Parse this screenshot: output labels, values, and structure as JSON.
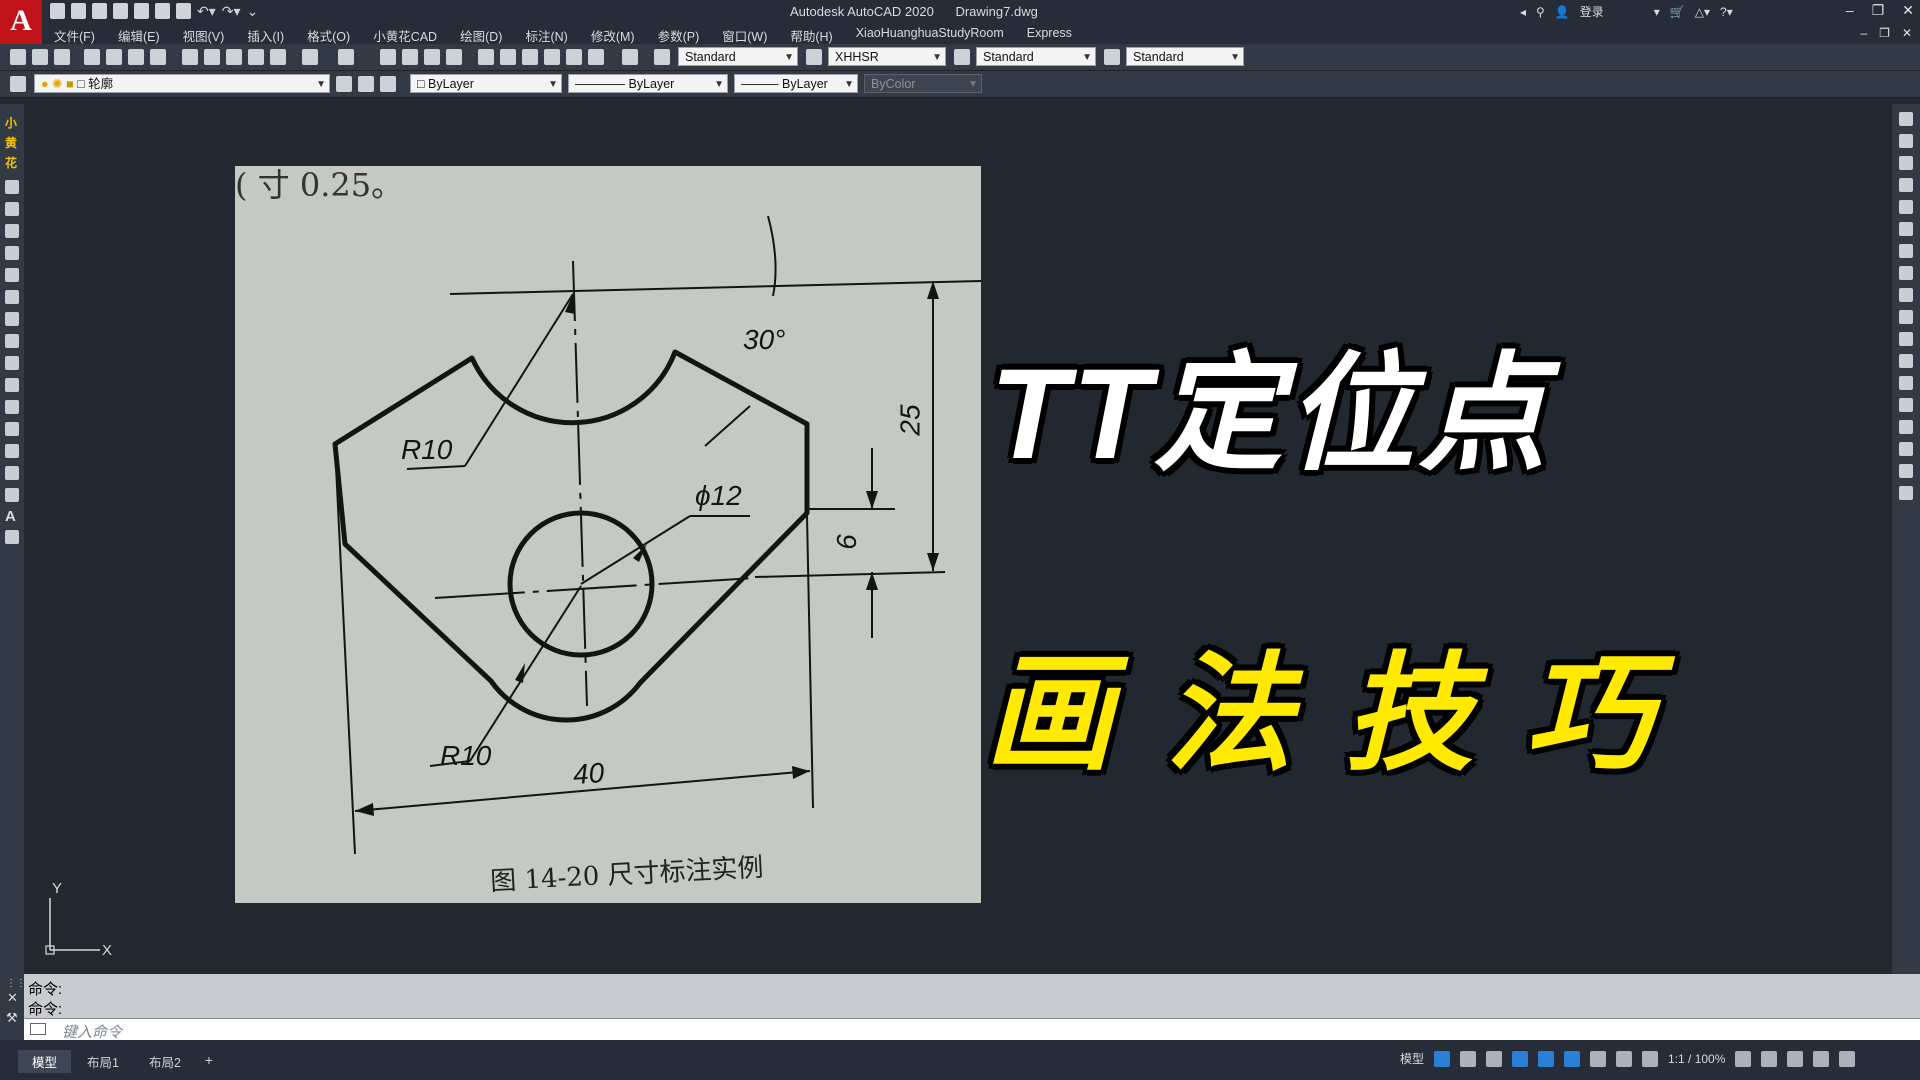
{
  "app": {
    "logo_letter": "A",
    "title": "Autodesk AutoCAD 2020",
    "document": "Drawing7.dwg",
    "login": "登录",
    "window_controls": [
      "–",
      "❐",
      "✕"
    ],
    "doc_controls": [
      "–",
      "❐",
      "✕"
    ]
  },
  "menu": [
    "文件(F)",
    "编辑(E)",
    "视图(V)",
    "插入(I)",
    "格式(O)",
    "小黄花CAD",
    "绘图(D)",
    "标注(N)",
    "修改(M)",
    "参数(P)",
    "窗口(W)",
    "帮助(H)",
    "XiaoHuanghuaStudyRoom",
    "Express"
  ],
  "toolbar": {
    "text_style": "Standard",
    "dim_style": "XHHSR",
    "table_style": "Standard",
    "multileader_style": "Standard",
    "layer": "轮廓",
    "color": "ByLayer",
    "linetype": "ByLayer",
    "lineweight": "ByLayer",
    "plot_style": "ByColor"
  },
  "left_toolbar": {
    "brand_chars": [
      "小",
      "黄",
      "花"
    ],
    "text_icon": "A"
  },
  "drawing": {
    "top_scrap": "( 寸 0.25。",
    "angle_label": "30°",
    "r10_upper": "R10",
    "diameter_label": "ϕ12",
    "dim_25": "25",
    "dim_6": "6",
    "r10_lower": "R10",
    "dim_40": "40",
    "caption": "图 14-20   尺寸标注实例"
  },
  "overlay": {
    "line1": "TT定位点",
    "line2": "画法技巧"
  },
  "ucs": {
    "x": "X",
    "y": "Y"
  },
  "command": {
    "history": [
      "命令:",
      "命令:"
    ],
    "placeholder": "键入命令"
  },
  "status": {
    "tabs": [
      "模型",
      "布局1",
      "布局2",
      "+"
    ],
    "model_label": "模型",
    "scale": "1:1 / 100%"
  },
  "colors": {
    "canvas": "#212830",
    "panel": "#323a46",
    "overlay_white": "#ffffff",
    "overlay_yellow": "#ffea00",
    "logo_red": "#c0121b"
  }
}
